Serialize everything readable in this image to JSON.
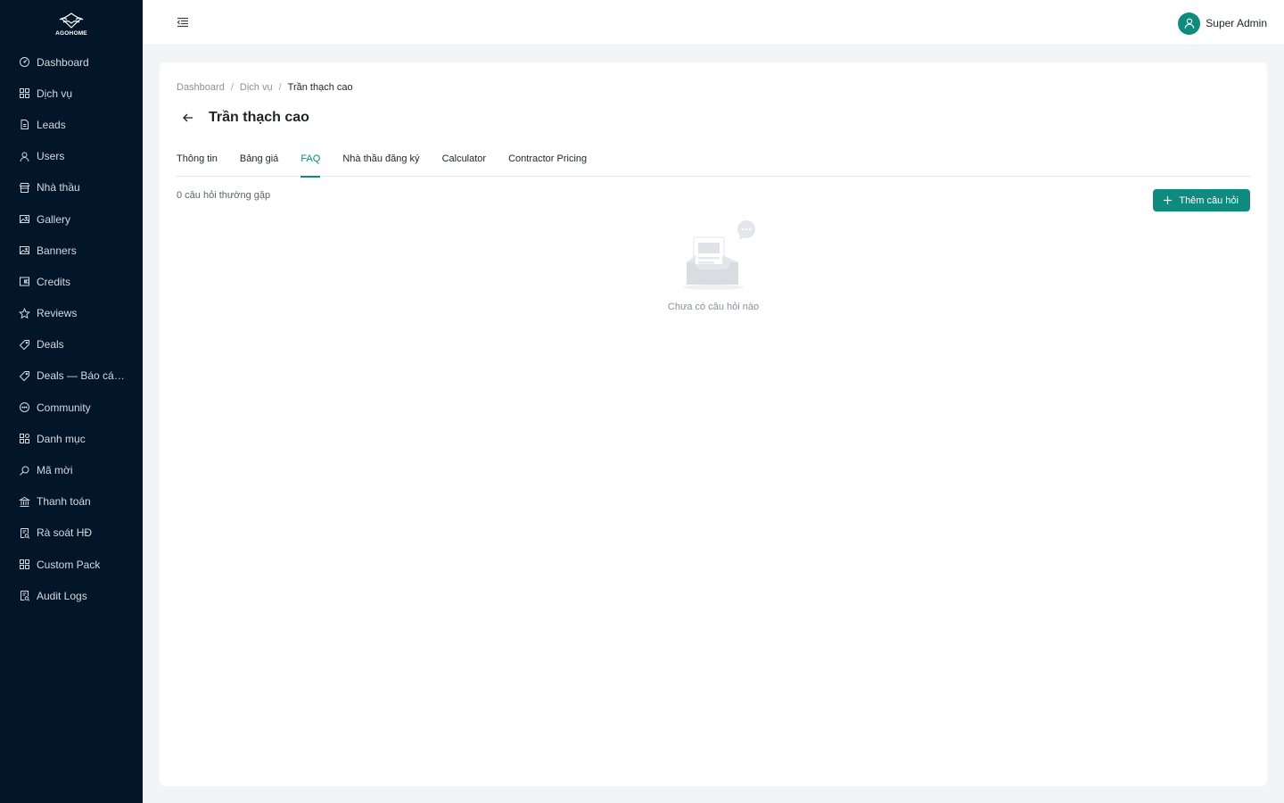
{
  "brand": {
    "name": "AGOHOME"
  },
  "sidebar": {
    "items": [
      {
        "label": "Dashboard",
        "icon": "dashboard-icon"
      },
      {
        "label": "Dịch vụ",
        "icon": "grid-icon"
      },
      {
        "label": "Leads",
        "icon": "document-icon"
      },
      {
        "label": "Users",
        "icon": "user-icon"
      },
      {
        "label": "Nhà thầu",
        "icon": "shop-icon"
      },
      {
        "label": "Gallery",
        "icon": "picture-icon"
      },
      {
        "label": "Banners",
        "icon": "picture-icon"
      },
      {
        "label": "Credits",
        "icon": "wallet-icon"
      },
      {
        "label": "Reviews",
        "icon": "star-icon"
      },
      {
        "label": "Deals",
        "icon": "tag-icon"
      },
      {
        "label": "Deals — Báo cáo ...",
        "icon": "tag-icon"
      },
      {
        "label": "Community",
        "icon": "message-icon"
      },
      {
        "label": "Danh mục",
        "icon": "category-icon"
      },
      {
        "label": "Mã mời",
        "icon": "search-icon"
      },
      {
        "label": "Thanh toán",
        "icon": "bank-icon"
      },
      {
        "label": "Rà soát HĐ",
        "icon": "audit-icon"
      },
      {
        "label": "Custom Pack",
        "icon": "grid-icon"
      },
      {
        "label": "Audit Logs",
        "icon": "audit-icon"
      }
    ]
  },
  "header": {
    "username": "Super Admin"
  },
  "breadcrumb": {
    "items": [
      "Dashboard",
      "Dịch vụ",
      "Trần thạch cao"
    ]
  },
  "page": {
    "title": "Trần thạch cao"
  },
  "tabs": [
    {
      "label": "Thông tin",
      "active": false
    },
    {
      "label": "Bảng giá",
      "active": false
    },
    {
      "label": "FAQ",
      "active": true
    },
    {
      "label": "Nhà thầu đăng ký",
      "active": false
    },
    {
      "label": "Calculator",
      "active": false
    },
    {
      "label": "Contractor Pricing",
      "active": false
    }
  ],
  "faq": {
    "count_text": "0 câu hỏi thường gặp",
    "add_button": "Thêm câu hỏi",
    "empty_text": "Chưa có câu hỏi nào"
  },
  "colors": {
    "sidebar_bg": "#031529",
    "accent": "#0f8a7e",
    "page_bg": "#f3f4f5"
  }
}
